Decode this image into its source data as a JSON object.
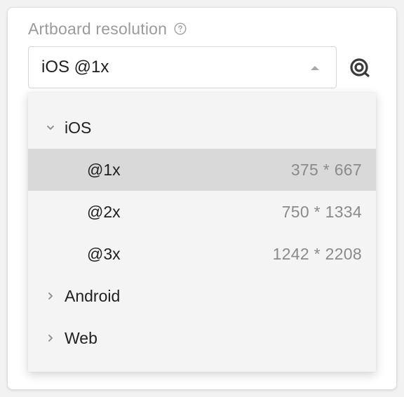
{
  "artboard": {
    "label": "Artboard resolution",
    "help_icon": "question-circle-icon",
    "select_value": "iOS @1x",
    "caret_icon": "caret-up-icon",
    "target_icon": "target-icon"
  },
  "dropdown": {
    "groups": [
      {
        "label": "iOS",
        "expanded": true,
        "chevron_icon": "chevron-down-icon",
        "options": [
          {
            "label": "@1x",
            "size": "375 * 667",
            "selected": true
          },
          {
            "label": "@2x",
            "size": "750 * 1334",
            "selected": false
          },
          {
            "label": "@3x",
            "size": "1242 * 2208",
            "selected": false
          }
        ]
      },
      {
        "label": "Android",
        "expanded": false,
        "chevron_icon": "chevron-right-icon"
      },
      {
        "label": "Web",
        "expanded": false,
        "chevron_icon": "chevron-right-icon"
      }
    ]
  },
  "colors": {
    "selected_row": "#d9d9d9",
    "dropdown_bg": "#f4f4f4",
    "label_gray": "#9b9b9b",
    "size_gray": "#8a8a8a",
    "text": "#1f1f1f"
  }
}
